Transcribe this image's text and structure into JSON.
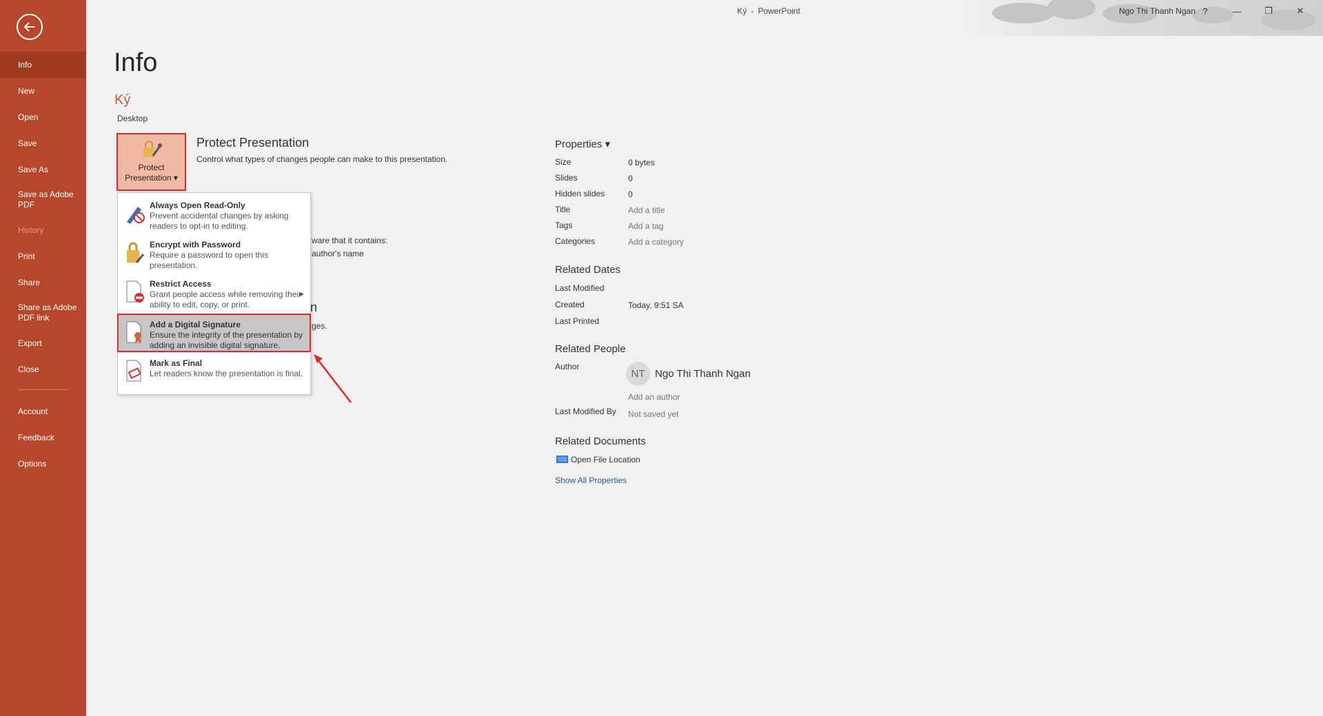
{
  "titlebar": {
    "doc_name": "Ký",
    "sep": "-",
    "app_name": "PowerPoint",
    "user": "Ngo Thi Thanh Ngan",
    "help": "?",
    "minimize": "—",
    "restore": "❐",
    "close": "✕"
  },
  "sidebar": {
    "items": [
      {
        "label": "Info"
      },
      {
        "label": "New"
      },
      {
        "label": "Open"
      },
      {
        "label": "Save"
      },
      {
        "label": "Save As"
      },
      {
        "label": "Save as Adobe PDF"
      },
      {
        "label": "History"
      },
      {
        "label": "Print"
      },
      {
        "label": "Share"
      },
      {
        "label": "Share as Adobe PDF link"
      },
      {
        "label": "Export"
      },
      {
        "label": "Close"
      }
    ],
    "bottom_items": [
      {
        "label": "Account"
      },
      {
        "label": "Feedback"
      },
      {
        "label": "Options"
      }
    ]
  },
  "main": {
    "title": "Info",
    "doc_name": "Ký",
    "location": "Desktop",
    "protect_button": {
      "line1": "Protect",
      "line2": "Presentation ▾"
    },
    "protect_title": "Protect Presentation",
    "protect_desc": "Control what types of changes people can make to this presentation.",
    "behind_text_1": "ware that it contains:",
    "behind_text_2": "author's name",
    "behind_text_3": "n",
    "behind_text_4": "ges."
  },
  "dropdown": {
    "items": [
      {
        "title": "Always Open Read-Only",
        "desc": "Prevent accidental changes by asking readers to opt-in to editing."
      },
      {
        "title": "Encrypt with Password",
        "desc": "Require a password to open this presentation."
      },
      {
        "title": "Restrict Access",
        "desc": "Grant people access while removing their ability to edit, copy, or print."
      },
      {
        "title": "Add a Digital Signature",
        "desc": "Ensure the integrity of the presentation by adding an invisible digital signature."
      },
      {
        "title": "Mark as Final",
        "desc": "Let readers know the presentation is final."
      }
    ],
    "submenu_arrow": "▶"
  },
  "properties": {
    "heading": "Properties ▾",
    "rows": [
      {
        "label": "Size",
        "value": "0 bytes"
      },
      {
        "label": "Slides",
        "value": "0"
      },
      {
        "label": "Hidden slides",
        "value": "0"
      },
      {
        "label": "Title",
        "value": "Add a title"
      },
      {
        "label": "Tags",
        "value": "Add a tag"
      },
      {
        "label": "Categories",
        "value": "Add a category"
      }
    ]
  },
  "related_dates": {
    "heading": "Related Dates",
    "last_modified": "Last Modified",
    "created": "Created",
    "created_value": "Today, 9:51 SA",
    "last_printed": "Last Printed"
  },
  "related_people": {
    "heading": "Related People",
    "author_label": "Author",
    "avatar_initials": "NT",
    "author_name": "Ngo Thi Thanh Ngan",
    "add_author": "Add an author",
    "last_modified_by": "Last Modified By",
    "not_saved": "Not saved yet"
  },
  "related_documents": {
    "heading": "Related Documents",
    "open_location": "Open File Location",
    "show_all": "Show All Properties"
  },
  "colors": {
    "sidebar": "#b7472a",
    "accent": "#c55a3b",
    "highlight_border": "#e3262a",
    "link": "#2b579a"
  }
}
